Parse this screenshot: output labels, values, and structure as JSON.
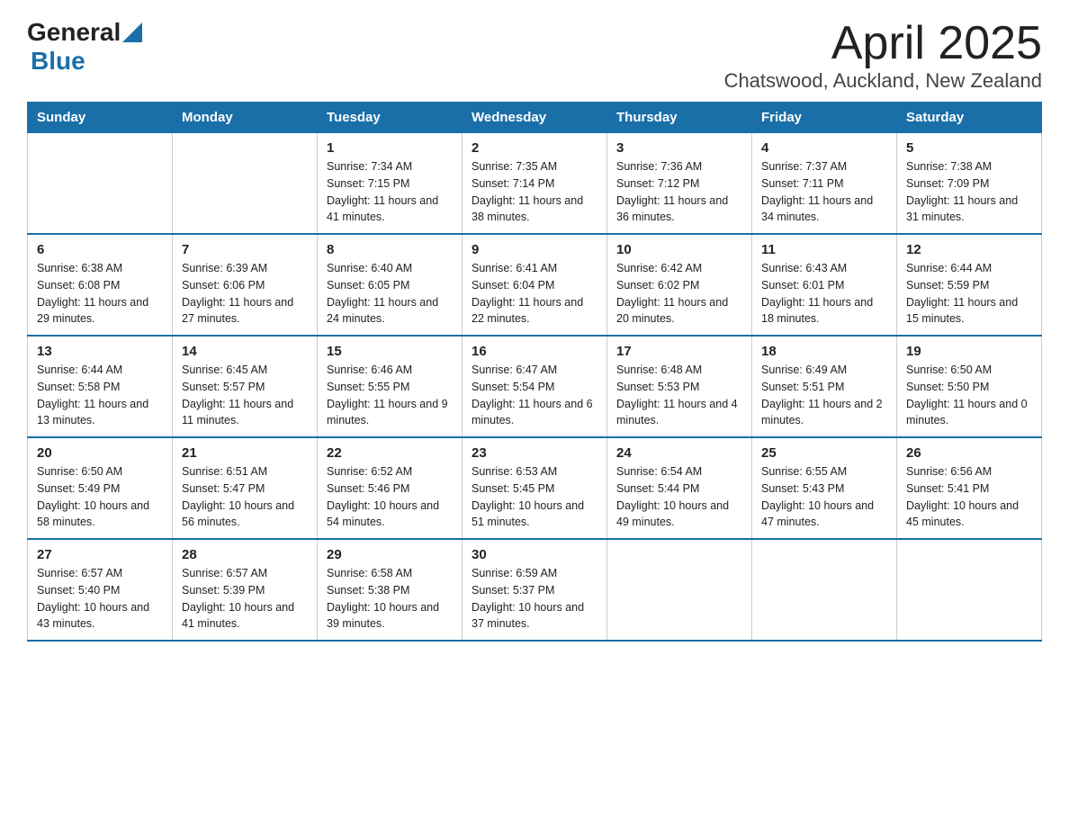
{
  "header": {
    "title": "April 2025",
    "subtitle": "Chatswood, Auckland, New Zealand",
    "logo_general": "General",
    "logo_blue": "Blue"
  },
  "days_of_week": [
    "Sunday",
    "Monday",
    "Tuesday",
    "Wednesday",
    "Thursday",
    "Friday",
    "Saturday"
  ],
  "weeks": [
    [
      {
        "day": "",
        "sunrise": "",
        "sunset": "",
        "daylight": ""
      },
      {
        "day": "",
        "sunrise": "",
        "sunset": "",
        "daylight": ""
      },
      {
        "day": "1",
        "sunrise": "Sunrise: 7:34 AM",
        "sunset": "Sunset: 7:15 PM",
        "daylight": "Daylight: 11 hours and 41 minutes."
      },
      {
        "day": "2",
        "sunrise": "Sunrise: 7:35 AM",
        "sunset": "Sunset: 7:14 PM",
        "daylight": "Daylight: 11 hours and 38 minutes."
      },
      {
        "day": "3",
        "sunrise": "Sunrise: 7:36 AM",
        "sunset": "Sunset: 7:12 PM",
        "daylight": "Daylight: 11 hours and 36 minutes."
      },
      {
        "day": "4",
        "sunrise": "Sunrise: 7:37 AM",
        "sunset": "Sunset: 7:11 PM",
        "daylight": "Daylight: 11 hours and 34 minutes."
      },
      {
        "day": "5",
        "sunrise": "Sunrise: 7:38 AM",
        "sunset": "Sunset: 7:09 PM",
        "daylight": "Daylight: 11 hours and 31 minutes."
      }
    ],
    [
      {
        "day": "6",
        "sunrise": "Sunrise: 6:38 AM",
        "sunset": "Sunset: 6:08 PM",
        "daylight": "Daylight: 11 hours and 29 minutes."
      },
      {
        "day": "7",
        "sunrise": "Sunrise: 6:39 AM",
        "sunset": "Sunset: 6:06 PM",
        "daylight": "Daylight: 11 hours and 27 minutes."
      },
      {
        "day": "8",
        "sunrise": "Sunrise: 6:40 AM",
        "sunset": "Sunset: 6:05 PM",
        "daylight": "Daylight: 11 hours and 24 minutes."
      },
      {
        "day": "9",
        "sunrise": "Sunrise: 6:41 AM",
        "sunset": "Sunset: 6:04 PM",
        "daylight": "Daylight: 11 hours and 22 minutes."
      },
      {
        "day": "10",
        "sunrise": "Sunrise: 6:42 AM",
        "sunset": "Sunset: 6:02 PM",
        "daylight": "Daylight: 11 hours and 20 minutes."
      },
      {
        "day": "11",
        "sunrise": "Sunrise: 6:43 AM",
        "sunset": "Sunset: 6:01 PM",
        "daylight": "Daylight: 11 hours and 18 minutes."
      },
      {
        "day": "12",
        "sunrise": "Sunrise: 6:44 AM",
        "sunset": "Sunset: 5:59 PM",
        "daylight": "Daylight: 11 hours and 15 minutes."
      }
    ],
    [
      {
        "day": "13",
        "sunrise": "Sunrise: 6:44 AM",
        "sunset": "Sunset: 5:58 PM",
        "daylight": "Daylight: 11 hours and 13 minutes."
      },
      {
        "day": "14",
        "sunrise": "Sunrise: 6:45 AM",
        "sunset": "Sunset: 5:57 PM",
        "daylight": "Daylight: 11 hours and 11 minutes."
      },
      {
        "day": "15",
        "sunrise": "Sunrise: 6:46 AM",
        "sunset": "Sunset: 5:55 PM",
        "daylight": "Daylight: 11 hours and 9 minutes."
      },
      {
        "day": "16",
        "sunrise": "Sunrise: 6:47 AM",
        "sunset": "Sunset: 5:54 PM",
        "daylight": "Daylight: 11 hours and 6 minutes."
      },
      {
        "day": "17",
        "sunrise": "Sunrise: 6:48 AM",
        "sunset": "Sunset: 5:53 PM",
        "daylight": "Daylight: 11 hours and 4 minutes."
      },
      {
        "day": "18",
        "sunrise": "Sunrise: 6:49 AM",
        "sunset": "Sunset: 5:51 PM",
        "daylight": "Daylight: 11 hours and 2 minutes."
      },
      {
        "day": "19",
        "sunrise": "Sunrise: 6:50 AM",
        "sunset": "Sunset: 5:50 PM",
        "daylight": "Daylight: 11 hours and 0 minutes."
      }
    ],
    [
      {
        "day": "20",
        "sunrise": "Sunrise: 6:50 AM",
        "sunset": "Sunset: 5:49 PM",
        "daylight": "Daylight: 10 hours and 58 minutes."
      },
      {
        "day": "21",
        "sunrise": "Sunrise: 6:51 AM",
        "sunset": "Sunset: 5:47 PM",
        "daylight": "Daylight: 10 hours and 56 minutes."
      },
      {
        "day": "22",
        "sunrise": "Sunrise: 6:52 AM",
        "sunset": "Sunset: 5:46 PM",
        "daylight": "Daylight: 10 hours and 54 minutes."
      },
      {
        "day": "23",
        "sunrise": "Sunrise: 6:53 AM",
        "sunset": "Sunset: 5:45 PM",
        "daylight": "Daylight: 10 hours and 51 minutes."
      },
      {
        "day": "24",
        "sunrise": "Sunrise: 6:54 AM",
        "sunset": "Sunset: 5:44 PM",
        "daylight": "Daylight: 10 hours and 49 minutes."
      },
      {
        "day": "25",
        "sunrise": "Sunrise: 6:55 AM",
        "sunset": "Sunset: 5:43 PM",
        "daylight": "Daylight: 10 hours and 47 minutes."
      },
      {
        "day": "26",
        "sunrise": "Sunrise: 6:56 AM",
        "sunset": "Sunset: 5:41 PM",
        "daylight": "Daylight: 10 hours and 45 minutes."
      }
    ],
    [
      {
        "day": "27",
        "sunrise": "Sunrise: 6:57 AM",
        "sunset": "Sunset: 5:40 PM",
        "daylight": "Daylight: 10 hours and 43 minutes."
      },
      {
        "day": "28",
        "sunrise": "Sunrise: 6:57 AM",
        "sunset": "Sunset: 5:39 PM",
        "daylight": "Daylight: 10 hours and 41 minutes."
      },
      {
        "day": "29",
        "sunrise": "Sunrise: 6:58 AM",
        "sunset": "Sunset: 5:38 PM",
        "daylight": "Daylight: 10 hours and 39 minutes."
      },
      {
        "day": "30",
        "sunrise": "Sunrise: 6:59 AM",
        "sunset": "Sunset: 5:37 PM",
        "daylight": "Daylight: 10 hours and 37 minutes."
      },
      {
        "day": "",
        "sunrise": "",
        "sunset": "",
        "daylight": ""
      },
      {
        "day": "",
        "sunrise": "",
        "sunset": "",
        "daylight": ""
      },
      {
        "day": "",
        "sunrise": "",
        "sunset": "",
        "daylight": ""
      }
    ]
  ]
}
